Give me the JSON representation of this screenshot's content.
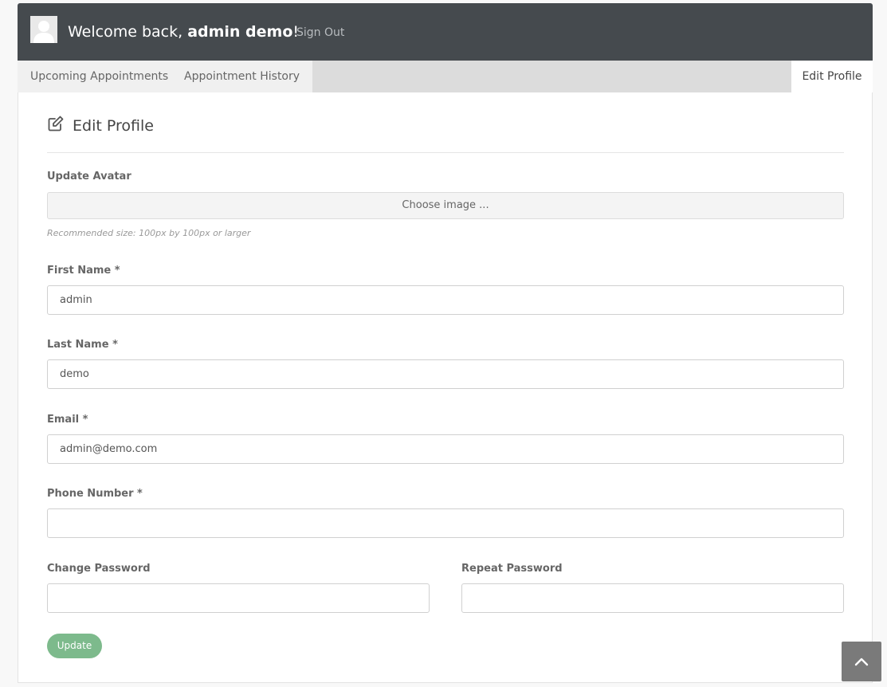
{
  "header": {
    "welcome_prefix": "Welcome back, ",
    "user_name": "admin demo",
    "welcome_suffix": "!",
    "sign_out": "Sign Out",
    "avatar_icon": "user-silhouette-icon"
  },
  "tabs": [
    {
      "label": "Upcoming Appointments",
      "active": false
    },
    {
      "label": "Appointment History",
      "active": false
    },
    {
      "label": "Edit Profile",
      "active": true
    }
  ],
  "panel": {
    "title": "Edit Profile",
    "title_icon": "edit-icon",
    "avatar": {
      "label": "Update Avatar",
      "button": "Choose image ...",
      "hint": "Recommended size: 100px by 100px or larger"
    },
    "first_name": {
      "label": "First Name *",
      "value": "admin"
    },
    "last_name": {
      "label": "Last Name *",
      "value": "demo"
    },
    "email": {
      "label": "Email *",
      "value": "admin@demo.com"
    },
    "phone": {
      "label": "Phone Number *",
      "value": ""
    },
    "change_password": {
      "label": "Change Password",
      "value": ""
    },
    "repeat_password": {
      "label": "Repeat Password",
      "value": ""
    },
    "update_button": "Update"
  },
  "scroll_top_icon": "chevron-up-icon",
  "colors": {
    "header_bg": "#454a4e",
    "update_button": "#7dba8c",
    "scroll_top_bg": "#7a7a7a"
  }
}
